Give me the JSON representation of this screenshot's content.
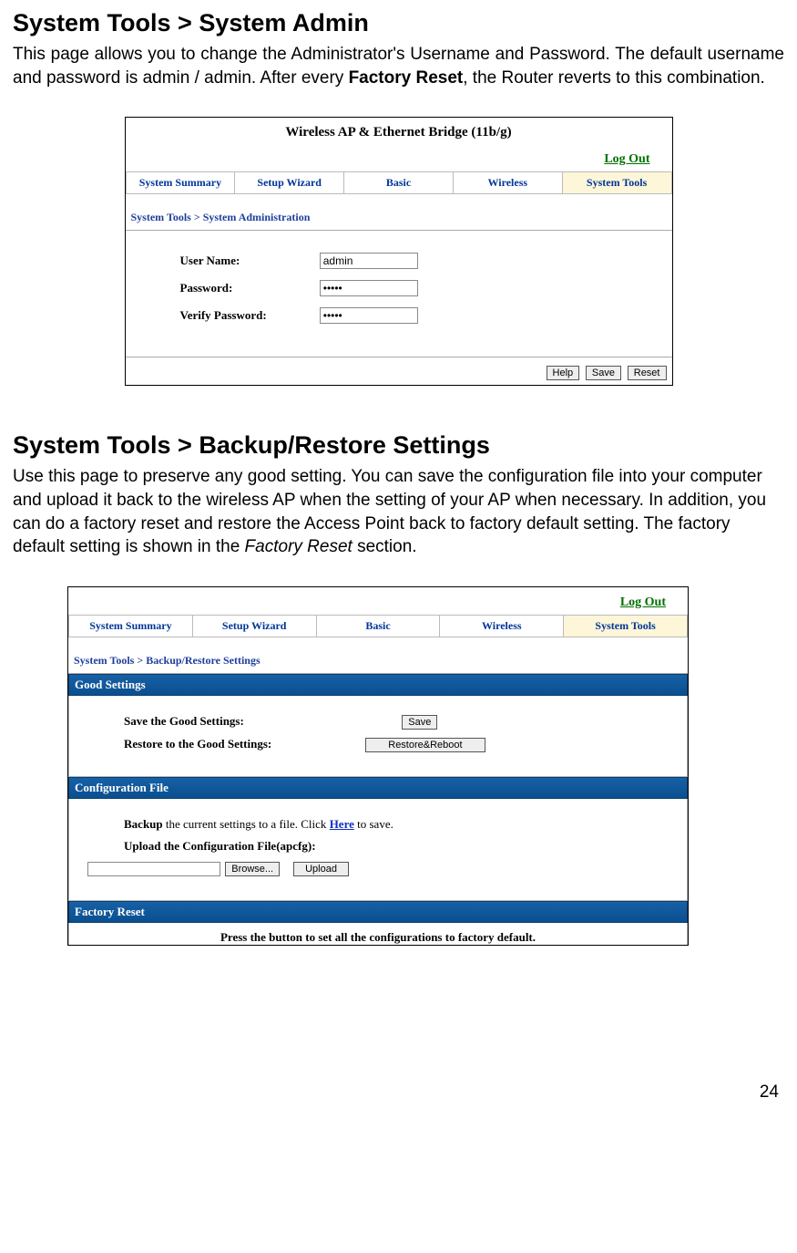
{
  "section1": {
    "heading": "System Tools > System Admin",
    "para_a": "This page allows you to change the Administrator's Username and Password. The default username and password is admin / admin. After every ",
    "para_bold": "Factory Reset",
    "para_b": ", the Router reverts to this combination."
  },
  "shot1": {
    "title": "Wireless AP & Ethernet Bridge (11b/g)",
    "logout": "Log Out",
    "tabs": [
      "System Summary",
      "Setup Wizard",
      "Basic",
      "Wireless",
      "System Tools"
    ],
    "breadcrumb": "System Tools > System Administration",
    "user_label": "User Name:",
    "user_value": "admin",
    "pass_label": "Password:",
    "pass_value": "•••••",
    "verify_label": "Verify Password:",
    "verify_value": "•••••",
    "buttons": [
      "Help",
      "Save",
      "Reset"
    ]
  },
  "section2": {
    "heading": "System Tools > Backup/Restore Settings",
    "para": "Use this page to preserve any good setting. You can save the configuration file into your computer and upload it back to the wireless AP when the setting of your AP when necessary. In addition, you can do a factory reset and restore the Access Point back to factory default setting. The factory default setting is shown in the ",
    "para_italic": "Factory Reset",
    "para_tail": " section."
  },
  "shot2": {
    "logout": "Log Out",
    "tabs": [
      "System Summary",
      "Setup Wizard",
      "Basic",
      "Wireless",
      "System Tools"
    ],
    "breadcrumb": "System Tools > Backup/Restore Settings",
    "good_title": "Good Settings",
    "save_label": "Save the Good Settings:",
    "save_btn": "Save",
    "restore_label": "Restore to the Good Settings:",
    "restore_btn": "Restore&Reboot",
    "conf_title": "Configuration File",
    "backup_a": "Backup",
    "backup_mid": " the current settings to a file. Click ",
    "backup_here": "Here",
    "backup_b": " to save.",
    "upload_label": "Upload the Configuration File(apcfg):",
    "browse_btn": "Browse...",
    "upload_btn": "Upload",
    "factory_title": "Factory Reset",
    "factory_text": "Press the button to set all the configurations to factory default."
  },
  "page_number": "24"
}
